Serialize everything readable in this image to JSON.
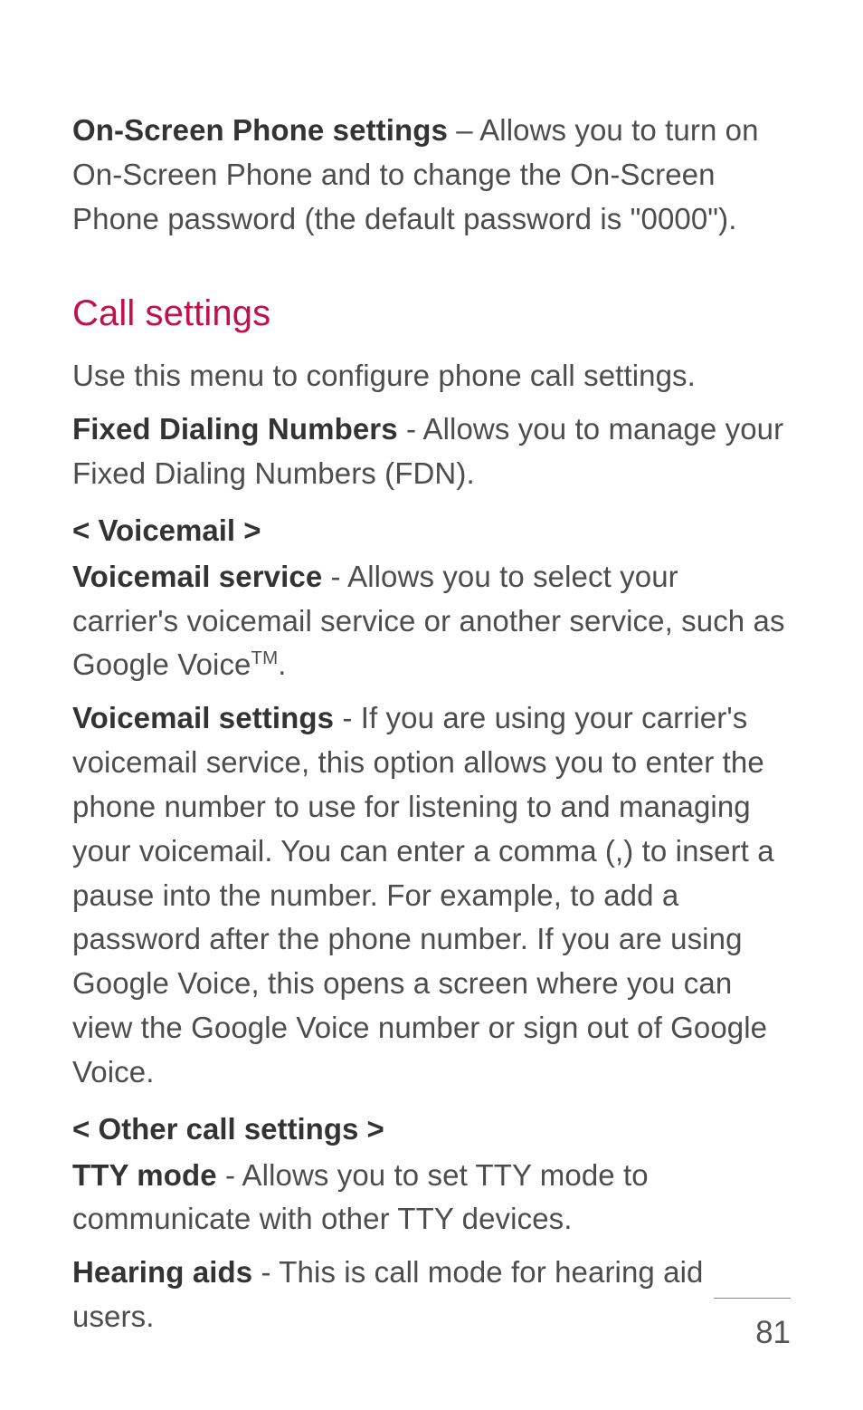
{
  "para1": {
    "bold": "On-Screen Phone settings",
    "rest": " – Allows you to turn on On-Screen Phone and to change the On-Screen Phone password (the default password is \"0000\")."
  },
  "heading_call_settings": "Call settings",
  "para_use_menu": "Use this menu to configure phone call settings.",
  "para_fdn": {
    "bold": "Fixed Dialing Numbers",
    "rest": " - Allows you to manage your Fixed Dialing Numbers (FDN)."
  },
  "sub_voicemail": "< Voicemail >",
  "para_vm_service": {
    "bold": "Voicemail service",
    "rest_pre": " - Allows you to select your carrier's voicemail service or another service, such as Google Voice",
    "sup": "TM",
    "rest_post": "."
  },
  "para_vm_settings": {
    "bold": "Voicemail settings",
    "rest": " - If you are using your carrier's voicemail service, this option allows you to enter the phone number to use for listening to and managing your voicemail. You can enter a comma (,) to insert a pause into the number. For example, to add a password after the phone number. If you are using Google Voice, this opens a screen where you can view the Google Voice number or sign out of Google Voice."
  },
  "sub_other": "< Other call settings >",
  "para_tty": {
    "bold": "TTY mode",
    "rest": " - Allows you to set TTY mode to communicate with other TTY devices."
  },
  "para_hearing": {
    "bold": "Hearing aids",
    "rest": " - This is call mode for hearing aid users."
  },
  "page_number": "81"
}
